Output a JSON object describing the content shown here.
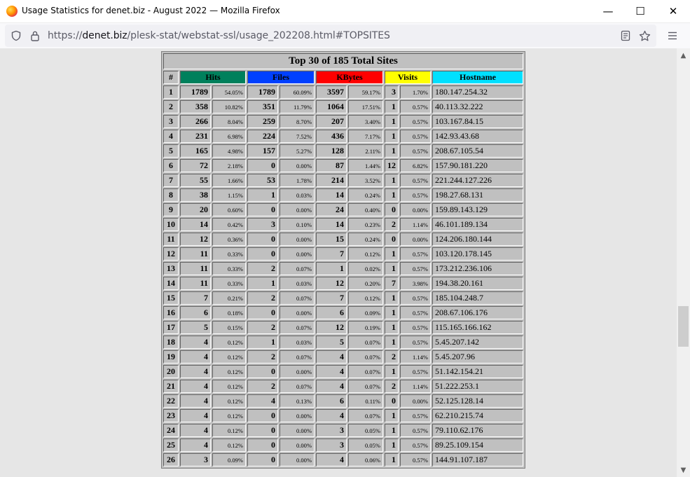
{
  "window": {
    "title": "Usage Statistics for denet.biz - August 2022 — Mozilla Firefox",
    "minimize_glyph": "—",
    "maximize_glyph": "☐",
    "close_glyph": "✕"
  },
  "address_bar": {
    "url_prefix": "https://",
    "url_domain": "denet.biz",
    "url_path": "/plesk-stat/webstat-ssl/usage_202208.html#TOPSITES"
  },
  "table": {
    "title": "Top 30 of 185 Total Sites",
    "headers": {
      "rank": "#",
      "hits": "Hits",
      "files": "Files",
      "kbytes": "KBytes",
      "visits": "Visits",
      "hostname": "Hostname"
    },
    "colors": {
      "hits": "#00805c",
      "files": "#0040ff",
      "kbytes": "#ff0000",
      "visits": "#ffff00",
      "hostname": "#00e0ff"
    },
    "rows": [
      [
        "1",
        "1789",
        "54.05%",
        "1789",
        "60.09%",
        "3597",
        "59.17%",
        "3",
        "1.70%",
        "180.147.254.32"
      ],
      [
        "2",
        "358",
        "10.82%",
        "351",
        "11.79%",
        "1064",
        "17.51%",
        "1",
        "0.57%",
        "40.113.32.222"
      ],
      [
        "3",
        "266",
        "8.04%",
        "259",
        "8.70%",
        "207",
        "3.40%",
        "1",
        "0.57%",
        "103.167.84.15"
      ],
      [
        "4",
        "231",
        "6.98%",
        "224",
        "7.52%",
        "436",
        "7.17%",
        "1",
        "0.57%",
        "142.93.43.68"
      ],
      [
        "5",
        "165",
        "4.98%",
        "157",
        "5.27%",
        "128",
        "2.11%",
        "1",
        "0.57%",
        "208.67.105.54"
      ],
      [
        "6",
        "72",
        "2.18%",
        "0",
        "0.00%",
        "87",
        "1.44%",
        "12",
        "6.82%",
        "157.90.181.220"
      ],
      [
        "7",
        "55",
        "1.66%",
        "53",
        "1.78%",
        "214",
        "3.52%",
        "1",
        "0.57%",
        "221.244.127.226"
      ],
      [
        "8",
        "38",
        "1.15%",
        "1",
        "0.03%",
        "14",
        "0.24%",
        "1",
        "0.57%",
        "198.27.68.131"
      ],
      [
        "9",
        "20",
        "0.60%",
        "0",
        "0.00%",
        "24",
        "0.40%",
        "0",
        "0.00%",
        "159.89.143.129"
      ],
      [
        "10",
        "14",
        "0.42%",
        "3",
        "0.10%",
        "14",
        "0.23%",
        "2",
        "1.14%",
        "46.101.189.134"
      ],
      [
        "11",
        "12",
        "0.36%",
        "0",
        "0.00%",
        "15",
        "0.24%",
        "0",
        "0.00%",
        "124.206.180.144"
      ],
      [
        "12",
        "11",
        "0.33%",
        "0",
        "0.00%",
        "7",
        "0.12%",
        "1",
        "0.57%",
        "103.120.178.145"
      ],
      [
        "13",
        "11",
        "0.33%",
        "2",
        "0.07%",
        "1",
        "0.02%",
        "1",
        "0.57%",
        "173.212.236.106"
      ],
      [
        "14",
        "11",
        "0.33%",
        "1",
        "0.03%",
        "12",
        "0.20%",
        "7",
        "3.98%",
        "194.38.20.161"
      ],
      [
        "15",
        "7",
        "0.21%",
        "2",
        "0.07%",
        "7",
        "0.12%",
        "1",
        "0.57%",
        "185.104.248.7"
      ],
      [
        "16",
        "6",
        "0.18%",
        "0",
        "0.00%",
        "6",
        "0.09%",
        "1",
        "0.57%",
        "208.67.106.176"
      ],
      [
        "17",
        "5",
        "0.15%",
        "2",
        "0.07%",
        "12",
        "0.19%",
        "1",
        "0.57%",
        "115.165.166.162"
      ],
      [
        "18",
        "4",
        "0.12%",
        "1",
        "0.03%",
        "5",
        "0.07%",
        "1",
        "0.57%",
        "5.45.207.142"
      ],
      [
        "19",
        "4",
        "0.12%",
        "2",
        "0.07%",
        "4",
        "0.07%",
        "2",
        "1.14%",
        "5.45.207.96"
      ],
      [
        "20",
        "4",
        "0.12%",
        "0",
        "0.00%",
        "4",
        "0.07%",
        "1",
        "0.57%",
        "51.142.154.21"
      ],
      [
        "21",
        "4",
        "0.12%",
        "2",
        "0.07%",
        "4",
        "0.07%",
        "2",
        "1.14%",
        "51.222.253.1"
      ],
      [
        "22",
        "4",
        "0.12%",
        "4",
        "0.13%",
        "6",
        "0.11%",
        "0",
        "0.00%",
        "52.125.128.14"
      ],
      [
        "23",
        "4",
        "0.12%",
        "0",
        "0.00%",
        "4",
        "0.07%",
        "1",
        "0.57%",
        "62.210.215.74"
      ],
      [
        "24",
        "4",
        "0.12%",
        "0",
        "0.00%",
        "3",
        "0.05%",
        "1",
        "0.57%",
        "79.110.62.176"
      ],
      [
        "25",
        "4",
        "0.12%",
        "0",
        "0.00%",
        "3",
        "0.05%",
        "1",
        "0.57%",
        "89.25.109.154"
      ],
      [
        "26",
        "3",
        "0.09%",
        "0",
        "0.00%",
        "4",
        "0.06%",
        "1",
        "0.57%",
        "144.91.107.187"
      ]
    ]
  }
}
